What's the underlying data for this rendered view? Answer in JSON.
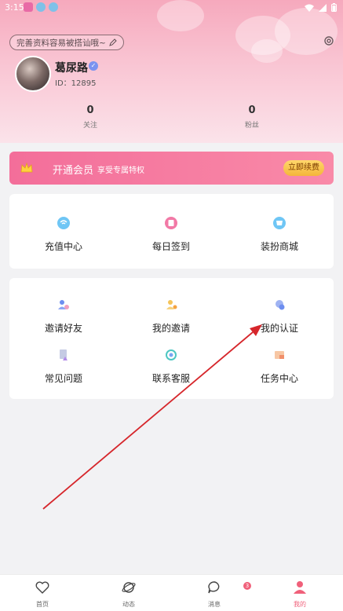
{
  "status": {
    "time": "3:15"
  },
  "profile": {
    "hint": "完善资料容易被搭讪哦~",
    "name": "葛尿路",
    "id": "ID：12895",
    "following_count": "0",
    "following_label": "关注",
    "fans_count": "0",
    "fans_label": "粉丝"
  },
  "vip": {
    "title": "开通会员",
    "subtitle": "享受专属特权",
    "button": "立即续费"
  },
  "quick": [
    {
      "label": "充值中心",
      "icon": "wallet-icon"
    },
    {
      "label": "每日签到",
      "icon": "calendar-icon"
    },
    {
      "label": "装扮商城",
      "icon": "shop-icon"
    }
  ],
  "services": [
    {
      "label": "邀请好友",
      "icon": "invite-icon"
    },
    {
      "label": "我的邀请",
      "icon": "my-invite-icon"
    },
    {
      "label": "我的认证",
      "icon": "certify-icon"
    },
    {
      "label": "常见问题",
      "icon": "faq-icon"
    },
    {
      "label": "联系客服",
      "icon": "support-icon"
    },
    {
      "label": "任务中心",
      "icon": "task-icon"
    }
  ],
  "tabs": [
    {
      "label": "首页",
      "icon": "heart-icon"
    },
    {
      "label": "动态",
      "icon": "planet-icon"
    },
    {
      "label": "消息",
      "icon": "chat-icon",
      "badge": "3"
    },
    {
      "label": "我的",
      "icon": "user-icon",
      "active": true
    }
  ],
  "colors": {
    "accent": "#f0607a",
    "vip_start": "#f36e9a",
    "vip_end": "#f98aa8"
  }
}
